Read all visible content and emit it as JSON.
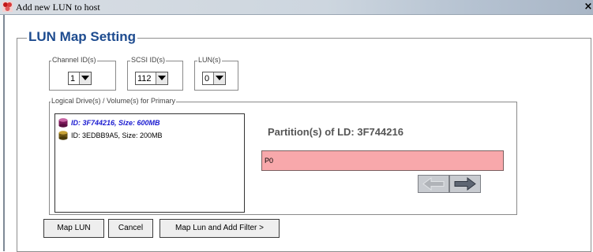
{
  "window": {
    "title": "Add new LUN to host",
    "close_glyph": "×"
  },
  "lun_map": {
    "title": "LUN Map Setting",
    "channel": {
      "label": "Channel ID(s)",
      "value": "1"
    },
    "scsi": {
      "label": "SCSI ID(s)",
      "value": "112"
    },
    "lun": {
      "label": "LUN(s)",
      "value": "0"
    }
  },
  "logical_drives": {
    "label": "Logical Drive(s) / Volume(s) for Primary",
    "items": [
      {
        "text": "ID: 3F744216, Size: 600MB",
        "selected": true,
        "icon": "disk-icon-purple"
      },
      {
        "text": "ID: 3EDBB9A5, Size: 200MB",
        "selected": false,
        "icon": "disk-icon-gold"
      }
    ]
  },
  "partitions": {
    "title": "Partition(s) of LD: 3F744216",
    "bar_label": "P0",
    "bar_color": "#f8a8ab"
  },
  "buttons": {
    "map_lun": "Map LUN",
    "cancel": "Cancel",
    "map_filter": "Map Lun and Add Filter >"
  }
}
